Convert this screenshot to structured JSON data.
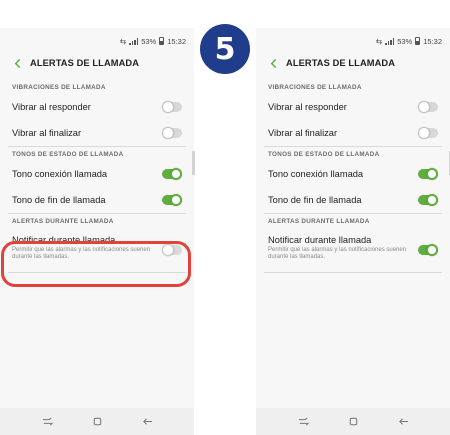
{
  "step": "5",
  "status": {
    "battery": "53%",
    "time": "15:32"
  },
  "title": "ALERTAS DE LLAMADA",
  "sections": {
    "vibration": "VIBRACIONES DE LLAMADA",
    "tones": "TONOS DE ESTADO DE LLAMADA",
    "alerts": "ALERTAS DURANTE LLAMADA"
  },
  "rows": {
    "vibrate_answer": "Vibrar al responder",
    "vibrate_end": "Vibrar al finalizar",
    "connect_tone": "Tono conexión llamada",
    "end_tone": "Tono de fin de llamada",
    "notify": "Notificar durante llamada",
    "notify_sub": "Permitir que las alarmas y las notificaciones suenen durante las llamadas."
  },
  "screens": [
    {
      "vibrate_answer": false,
      "vibrate_end": false,
      "connect_tone": true,
      "end_tone": true,
      "notify": false
    },
    {
      "vibrate_answer": false,
      "vibrate_end": false,
      "connect_tone": true,
      "end_tone": true,
      "notify": true
    }
  ],
  "colors": {
    "accent": "#5fae3f",
    "highlight": "#e0433a",
    "badge": "#1f3d8a"
  },
  "icons": [
    "back-arrow-icon",
    "recents-icon",
    "home-icon",
    "back-nav-icon",
    "signal-icon",
    "battery-icon"
  ]
}
